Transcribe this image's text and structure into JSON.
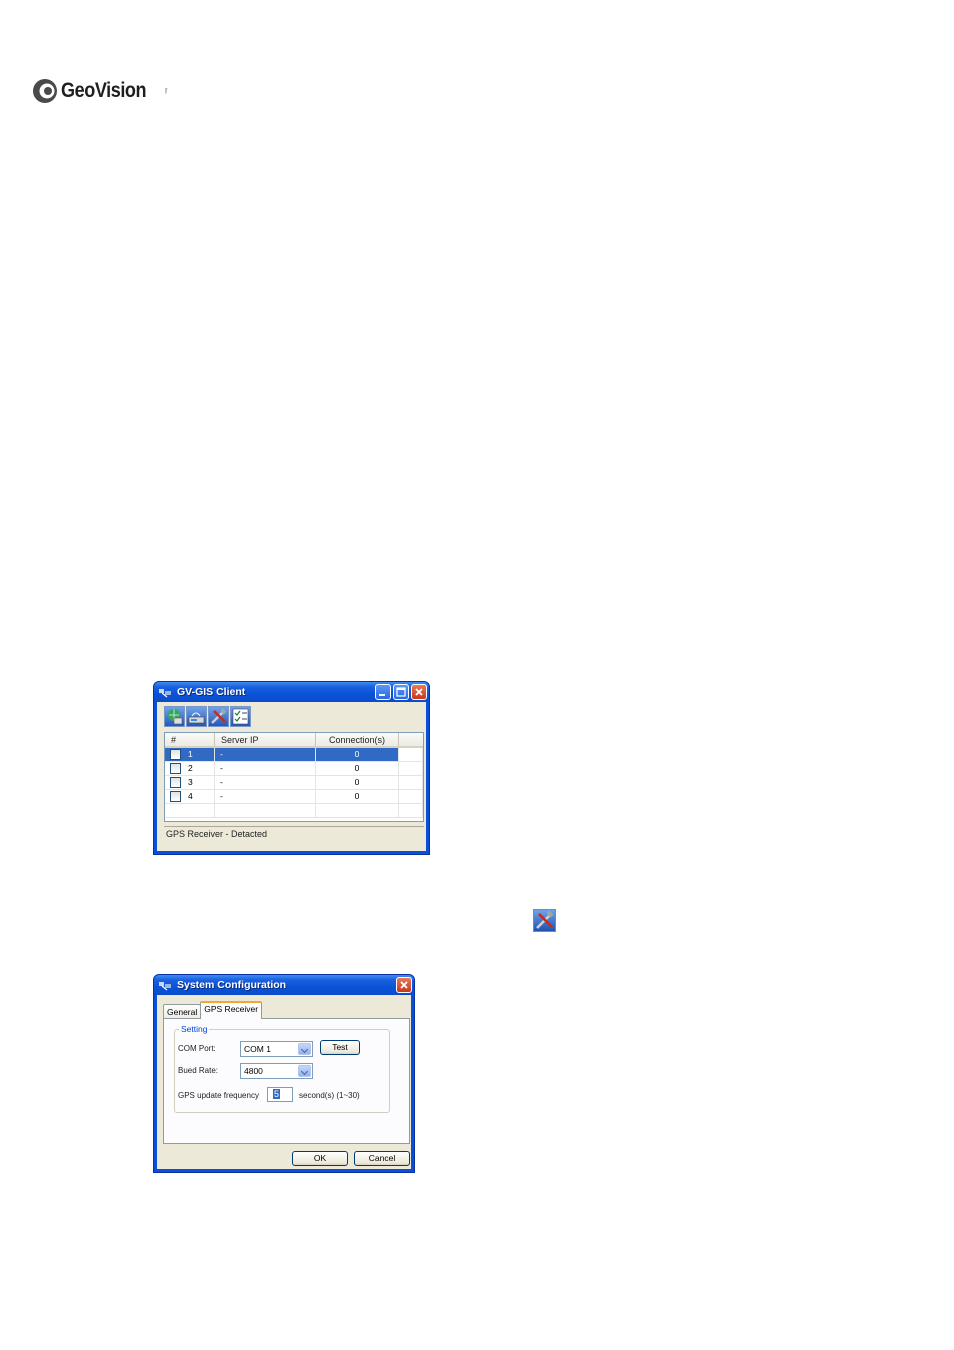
{
  "logo": {
    "text": "GeoVision",
    "tm": "Inc."
  },
  "gis_client": {
    "title": "GV-GIS Client",
    "toolbar": [
      {
        "icon": "globe-computer-icon"
      },
      {
        "icon": "gps-device-icon"
      },
      {
        "icon": "tools-icon"
      },
      {
        "icon": "checklist-icon"
      }
    ],
    "columns": [
      "#",
      "Server IP",
      "Connection(s)"
    ],
    "rows": [
      {
        "num": "1",
        "ip": "-",
        "conn": "0",
        "selected": true
      },
      {
        "num": "2",
        "ip": "-",
        "conn": "0",
        "selected": false
      },
      {
        "num": "3",
        "ip": "-",
        "conn": "0",
        "selected": false
      },
      {
        "num": "4",
        "ip": "-",
        "conn": "0",
        "selected": false
      }
    ],
    "status": "GPS Receiver - Detacted"
  },
  "inline_icon": "tools-icon",
  "sys_config": {
    "title": "System Configuration",
    "tabs": [
      "General",
      "GPS Receiver"
    ],
    "active_tab": "GPS Receiver",
    "group_label": "Setting",
    "com_port_label": "COM Port:",
    "com_port_value": "COM  1",
    "test_button": "Test",
    "baud_label": "Bued Rate:",
    "baud_value": "4800",
    "freq_label": "GPS update frequency",
    "freq_value": "5",
    "freq_suffix": "second(s) (1~30)",
    "ok_button": "OK",
    "cancel_button": "Cancel"
  },
  "colors": {
    "title_bar": "#0a53d6",
    "selection": "#316ac5",
    "window_bg": "#ece9d8"
  }
}
